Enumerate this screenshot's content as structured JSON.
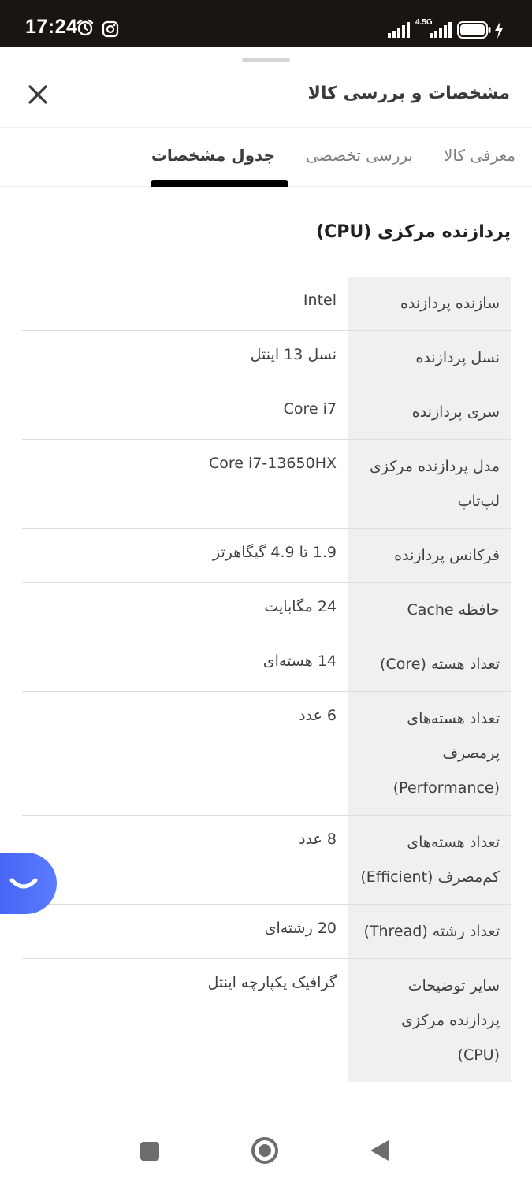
{
  "status_bar": {
    "time": "17:24",
    "network": "4.5G",
    "icons": [
      "alarm-icon",
      "instagram-icon",
      "signal-icon",
      "battery-icon",
      "charging-icon"
    ]
  },
  "header": {
    "title": "مشخصات و بررسی کالا",
    "close_icon": "close-icon"
  },
  "tabs": [
    {
      "label": "معرفی کالا",
      "active": false
    },
    {
      "label": "بررسی تخصصی",
      "active": false
    },
    {
      "label": "جدول مشخصات",
      "active": true
    }
  ],
  "section": {
    "title": "پردازنده مرکزی (CPU)"
  },
  "specs": [
    {
      "key": "سازنده پردازنده",
      "value": "Intel"
    },
    {
      "key": "نسل پردازنده",
      "value": "نسل 13 اینتل"
    },
    {
      "key": "سری پردازنده",
      "value": "Core i7"
    },
    {
      "key": "مدل پردازنده مرکزی لپ‌تاپ",
      "value": "Core i7-13650HX"
    },
    {
      "key": "فرکانس پردازنده",
      "value": "1.9 تا 4.9 گیگاهرتز"
    },
    {
      "key": "حافظه Cache",
      "value": "24 مگابایت"
    },
    {
      "key": "تعداد هسته (Core)",
      "value": "14 هسته‌ای"
    },
    {
      "key": "تعداد هسته‌های پرمصرف (Performance)",
      "value": "6 عدد"
    },
    {
      "key": "تعداد هسته‌های کم‌مصرف (Efficient)",
      "value": "8 عدد"
    },
    {
      "key": "تعداد رشته (Thread)",
      "value": "20 رشته‌ای"
    },
    {
      "key": "سایر توضیحات پردازنده مرکزی (CPU)",
      "value": "گرافیک یکپارچه اینتل"
    }
  ],
  "chat_fab": {
    "icon": "chat-smile-icon",
    "color": "#4a6af5"
  },
  "nav_bar": {
    "icons": [
      "recent-apps-icon",
      "home-icon",
      "back-icon"
    ]
  },
  "colors": {
    "status_bar_bg": "#1a1511",
    "active_tab_indicator": "#000000",
    "spec_key_bg": "#f0f0f0",
    "divider": "#dddddd"
  }
}
